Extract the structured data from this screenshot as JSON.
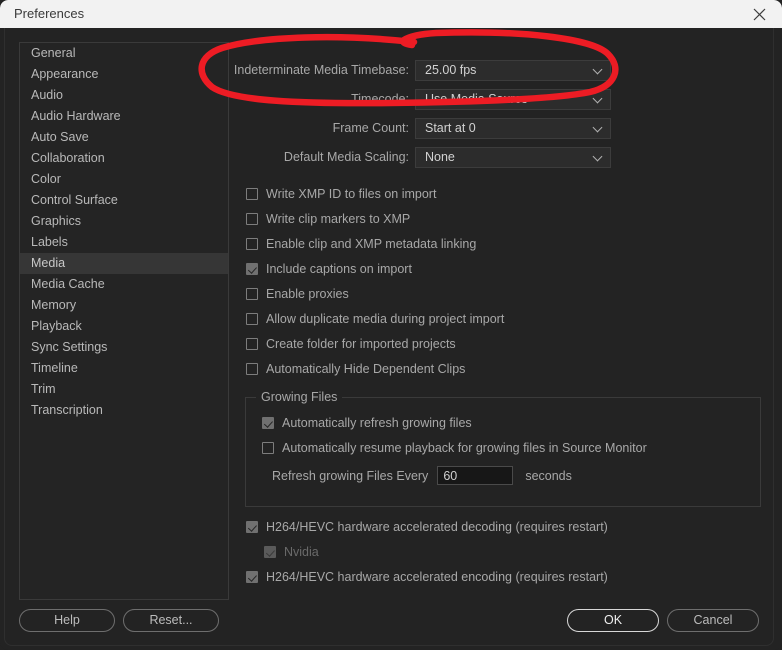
{
  "window": {
    "title": "Preferences",
    "close_icon": "close-icon"
  },
  "sidebar": {
    "items": [
      {
        "label": "General",
        "selected": false
      },
      {
        "label": "Appearance",
        "selected": false
      },
      {
        "label": "Audio",
        "selected": false
      },
      {
        "label": "Audio Hardware",
        "selected": false
      },
      {
        "label": "Auto Save",
        "selected": false
      },
      {
        "label": "Collaboration",
        "selected": false
      },
      {
        "label": "Color",
        "selected": false
      },
      {
        "label": "Control Surface",
        "selected": false
      },
      {
        "label": "Graphics",
        "selected": false
      },
      {
        "label": "Labels",
        "selected": false
      },
      {
        "label": "Media",
        "selected": true
      },
      {
        "label": "Media Cache",
        "selected": false
      },
      {
        "label": "Memory",
        "selected": false
      },
      {
        "label": "Playback",
        "selected": false
      },
      {
        "label": "Sync Settings",
        "selected": false
      },
      {
        "label": "Timeline",
        "selected": false
      },
      {
        "label": "Trim",
        "selected": false
      },
      {
        "label": "Transcription",
        "selected": false
      }
    ]
  },
  "main": {
    "dropdowns": [
      {
        "label": "Indeterminate Media Timebase:",
        "value": "25.00 fps",
        "caret": "chevron-down-icon"
      },
      {
        "label": "Timecode:",
        "value": "Use Media Source",
        "caret": "chevron-down-icon"
      },
      {
        "label": "Frame Count:",
        "value": "Start at 0",
        "caret": "chevron-down-icon"
      },
      {
        "label": "Default Media Scaling:",
        "value": "None",
        "caret": "chevron-down-icon"
      }
    ],
    "checkboxes": [
      {
        "label": "Write XMP ID to files on import",
        "checked": false
      },
      {
        "label": "Write clip markers to XMP",
        "checked": false
      },
      {
        "label": "Enable clip and XMP metadata linking",
        "checked": false
      },
      {
        "label": "Include captions on import",
        "checked": true
      },
      {
        "label": "Enable proxies",
        "checked": false
      },
      {
        "label": "Allow duplicate media during project import",
        "checked": false
      },
      {
        "label": "Create folder for imported projects",
        "checked": false
      },
      {
        "label": "Automatically Hide Dependent Clips",
        "checked": false
      }
    ],
    "growing_files": {
      "title": "Growing Files",
      "checkboxes": [
        {
          "label": "Automatically refresh growing files",
          "checked": true
        },
        {
          "label": "Automatically resume playback for growing files in Source Monitor",
          "checked": false
        }
      ],
      "refresh_label": "Refresh growing Files Every",
      "refresh_value": "60",
      "refresh_placeholder": "60",
      "refresh_unit": "seconds"
    },
    "hardware": [
      {
        "label": "H264/HEVC hardware accelerated decoding (requires restart)",
        "checked": true,
        "indent": 0,
        "disabled": false
      },
      {
        "label": "Nvidia",
        "checked": true,
        "indent": 1,
        "disabled": true
      },
      {
        "label": "H264/HEVC hardware accelerated encoding (requires restart)",
        "checked": true,
        "indent": 0,
        "disabled": false
      }
    ]
  },
  "footer": {
    "help": "Help",
    "reset": "Reset...",
    "ok": "OK",
    "cancel": "Cancel"
  },
  "annotation": {
    "shape": "hand-drawn-red-ellipse",
    "color": "#ed1c24",
    "targets": "Indeterminate Media Timebase"
  },
  "colors": {
    "dialog_background": "#232323",
    "titlebar_background": "#f2f2f2",
    "selected_row": "#363636",
    "annotation_red": "#ed1c24"
  }
}
